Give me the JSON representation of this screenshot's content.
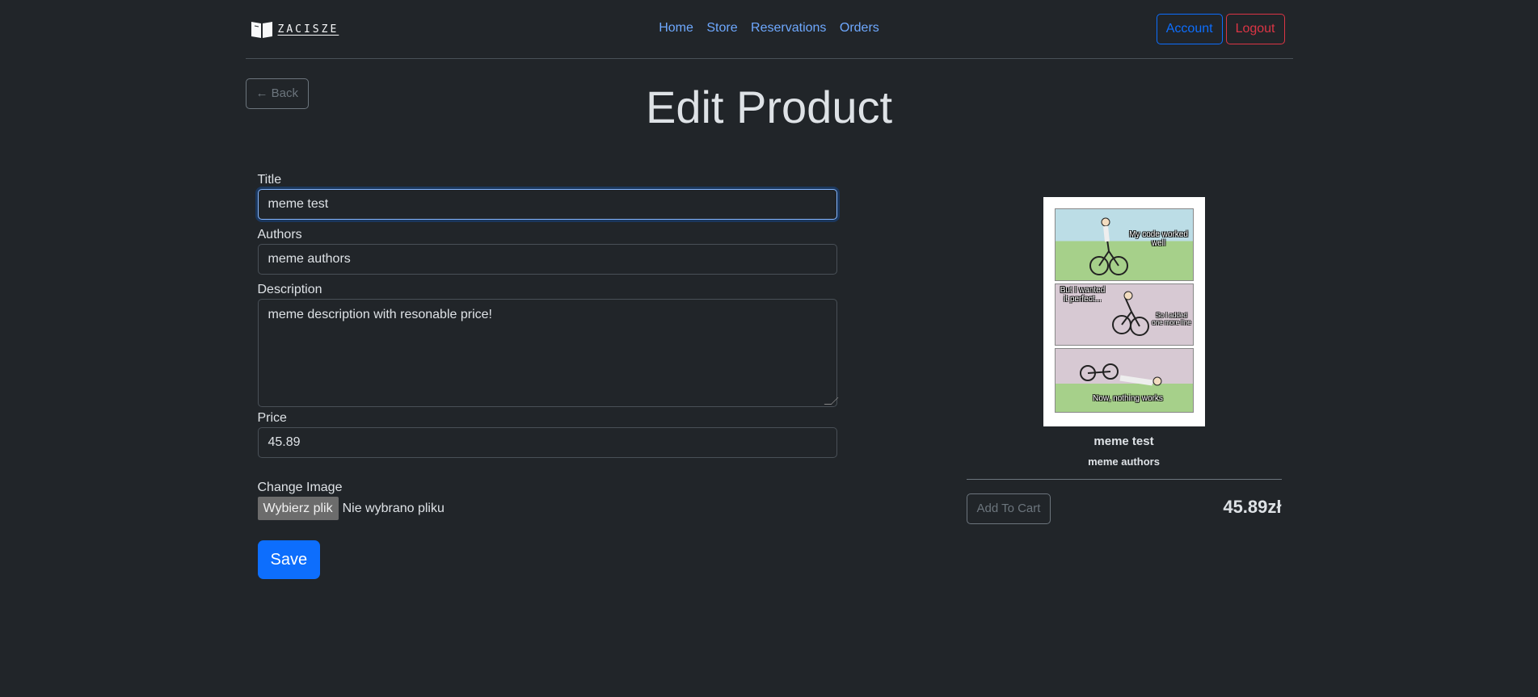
{
  "header": {
    "logo_text": "ZACISZE",
    "nav": [
      "Home",
      "Store",
      "Reservations",
      "Orders"
    ],
    "account_label": "Account",
    "logout_label": "Logout"
  },
  "back_label": "← Back",
  "page_title": "Edit Product",
  "form": {
    "title_label": "Title",
    "title_value": "meme test",
    "authors_label": "Authors",
    "authors_value": "meme authors",
    "description_label": "Description",
    "description_value": "meme description with resonable price!",
    "price_label": "Price",
    "price_value": "45.89",
    "image_label": "Change Image",
    "file_button": "Wybierz plik",
    "file_status": "Nie wybrano pliku",
    "save_label": "Save"
  },
  "card": {
    "title": "meme test",
    "authors": "meme authors",
    "add_to_cart": "Add To Cart",
    "price": "45.89zł",
    "image_text": {
      "panel1": "My code worked well",
      "panel2a": "But I wanted it perfect...",
      "panel2b": "So I added one more line",
      "panel3": "Now, nothing works"
    }
  },
  "colors": {
    "background": "#212529",
    "link": "#6ea8fe",
    "primary": "#0d6efd",
    "danger": "#dc3545"
  }
}
